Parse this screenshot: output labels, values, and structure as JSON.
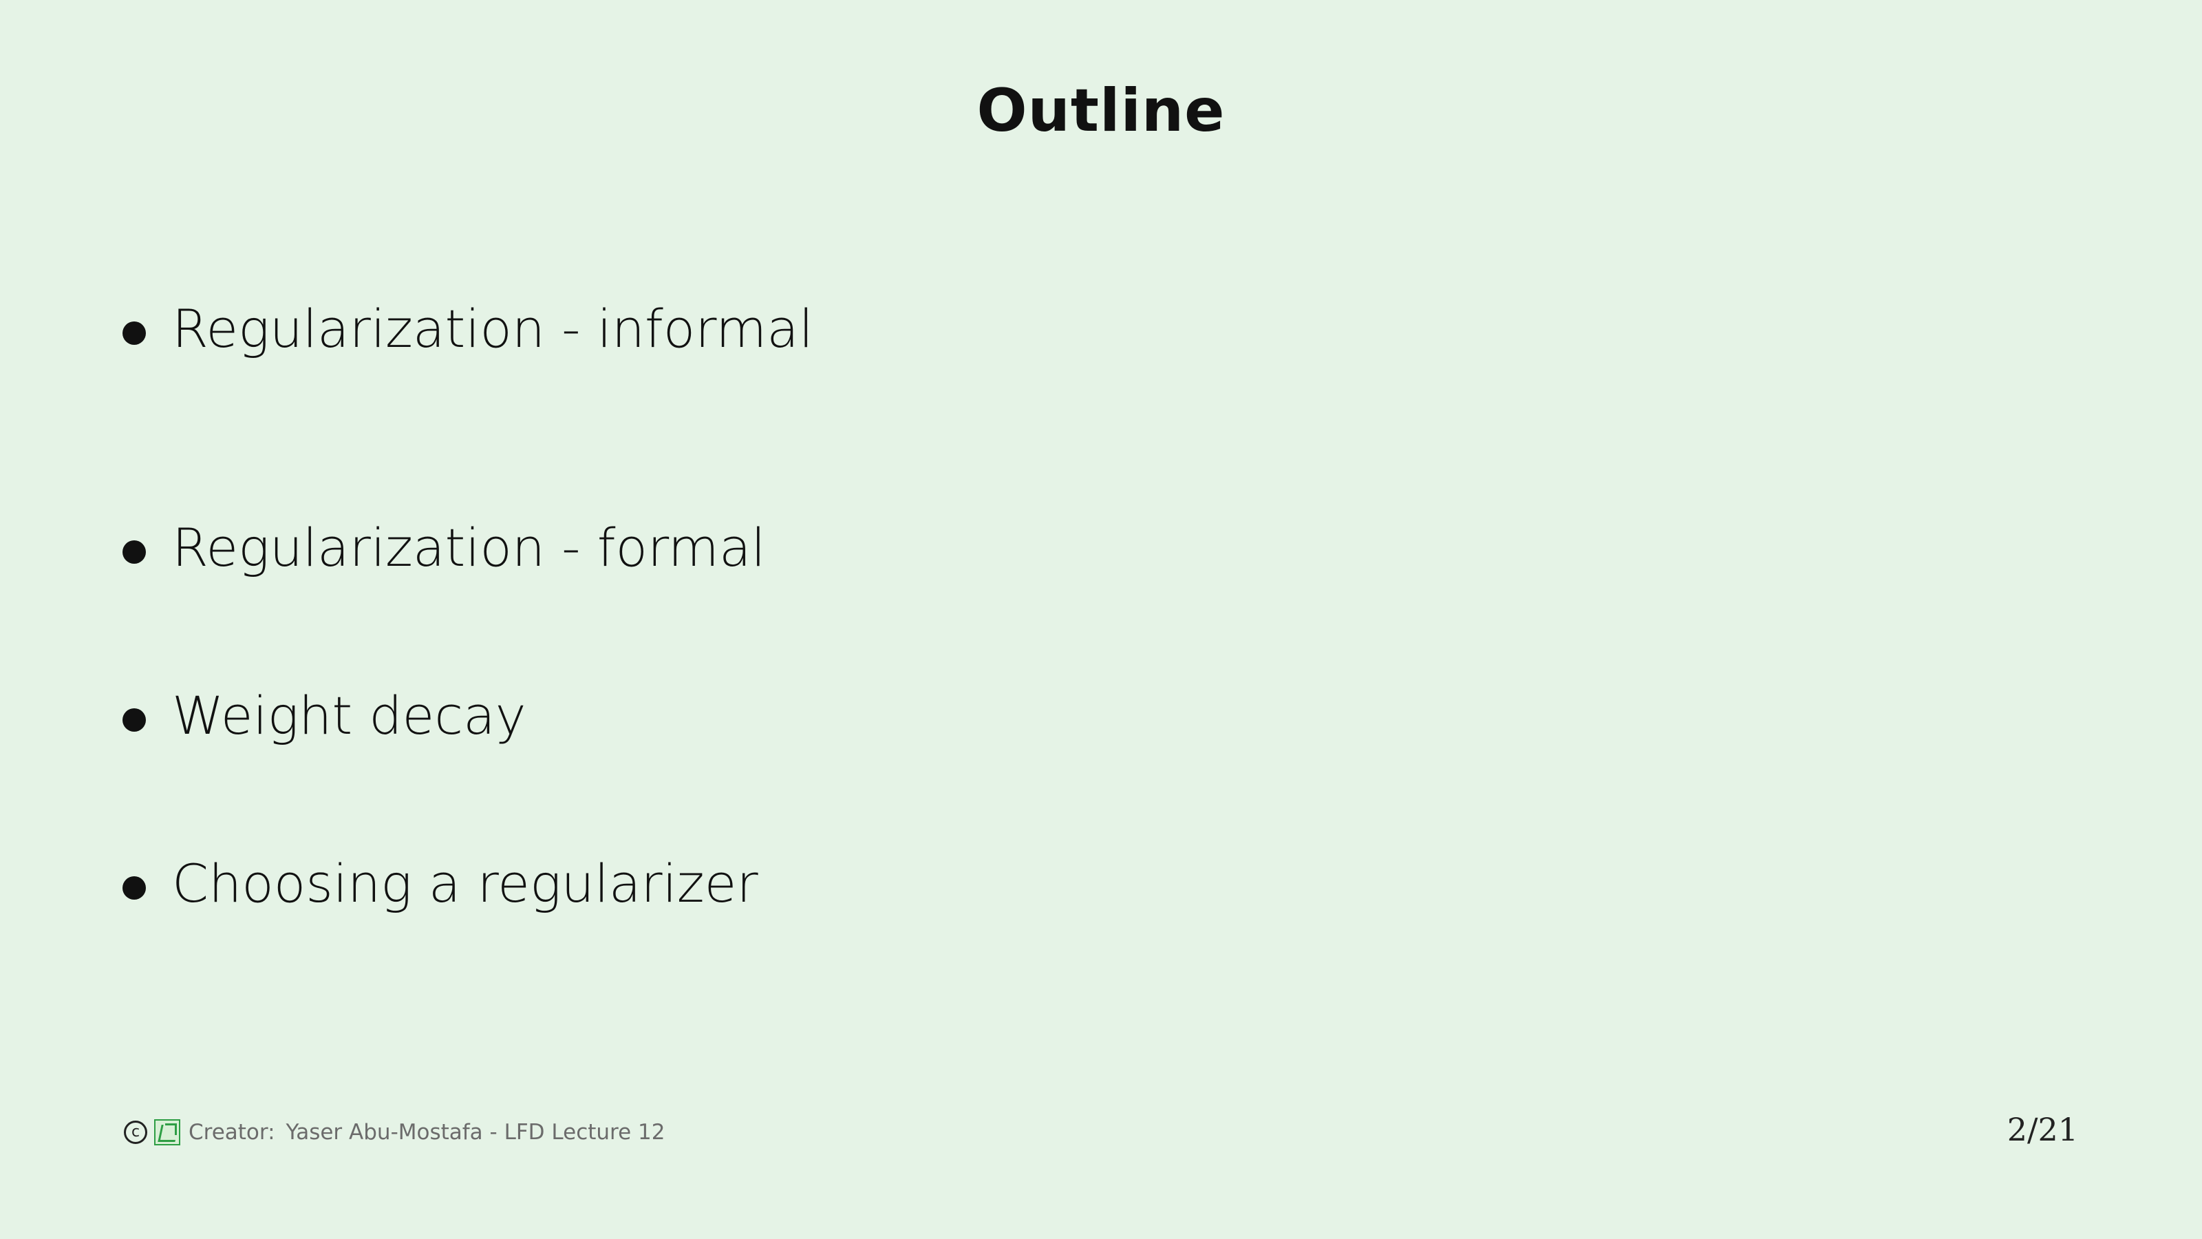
{
  "slide": {
    "title": "Outline",
    "bullets": [
      {
        "text": "Regularization - informal"
      },
      {
        "text": "Regularization - formal"
      },
      {
        "text": "Weight decay"
      },
      {
        "text": "Choosing a regularizer"
      }
    ]
  },
  "footer": {
    "copyright_icon": "copyright-icon",
    "copyright_symbol": "c",
    "logo_icon": "caltech-learning-logo-icon",
    "creator_label": "Creator:",
    "creator_text": "Yaser Abu-Mostafa - LFD Lecture 12",
    "page_number": "2/21"
  },
  "colors": {
    "background": "#e5f3e6",
    "text": "#111111",
    "footer_text": "#6b6b6b",
    "logo_green": "#2e9e44"
  }
}
